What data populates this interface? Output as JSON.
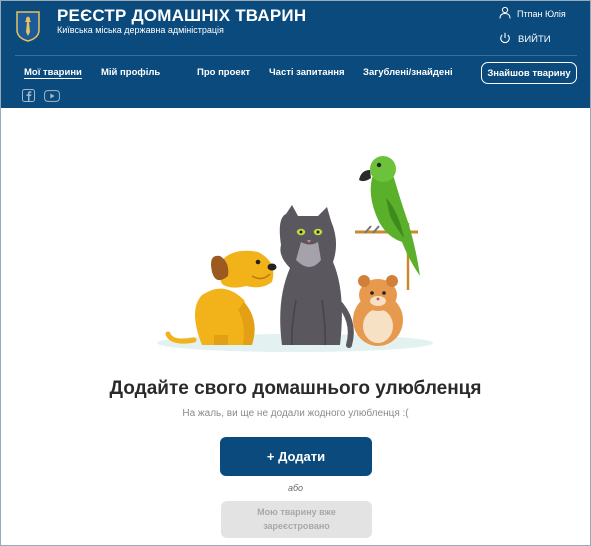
{
  "header": {
    "title": "РЕЄСТР ДОМАШНІХ ТВАРИН",
    "subtitle": "Київська міська державна адміністрація",
    "user_name": "Птпан Юлія",
    "logout_label": "ВИЙТИ"
  },
  "nav": {
    "items": [
      {
        "label": "Мої тварини",
        "active": true
      },
      {
        "label": "Мій профіль",
        "active": false
      },
      {
        "label": "Про проект",
        "active": false
      },
      {
        "label": "Часті запитання",
        "active": false
      },
      {
        "label": "Загублені/знайдені",
        "active": false
      }
    ],
    "found_button": "Знайшов тварину"
  },
  "social": [
    "facebook-icon",
    "youtube-icon"
  ],
  "main": {
    "heading": "Додайте свого домашнього улюбленця",
    "empty_text": "На жаль, ви ще не додали жодного улюбленця :(",
    "add_button": "+ Додати",
    "or_text": "або",
    "registered_button_line1": "Мою тварину вже",
    "registered_button_line2": "зареєстровано"
  },
  "colors": {
    "brand": "#0a4a7c",
    "disabled_bg": "#e3e3e3",
    "disabled_text": "#a8a8a8"
  }
}
